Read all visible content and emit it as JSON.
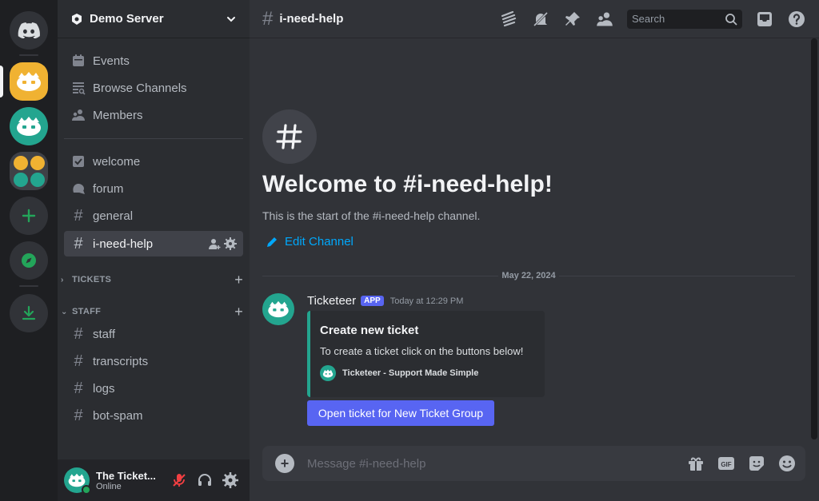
{
  "server": {
    "name": "Demo Server"
  },
  "sidebar": {
    "top_items": [
      {
        "label": "Events"
      },
      {
        "label": "Browse Channels"
      },
      {
        "label": "Members"
      }
    ],
    "channels": [
      {
        "label": "welcome"
      },
      {
        "label": "forum"
      },
      {
        "label": "general"
      },
      {
        "label": "i-need-help"
      }
    ],
    "categories": [
      {
        "label": "TICKETS"
      },
      {
        "label": "STAFF"
      }
    ],
    "staff_channels": [
      {
        "label": "staff"
      },
      {
        "label": "transcripts"
      },
      {
        "label": "logs"
      },
      {
        "label": "bot-spam"
      }
    ]
  },
  "user": {
    "name": "The Ticket...",
    "status": "Online"
  },
  "header": {
    "channel": "i-need-help",
    "search_placeholder": "Search"
  },
  "welcome": {
    "title": "Welcome to #i-need-help!",
    "subtitle": "This is the start of the #i-need-help channel.",
    "edit_label": "Edit Channel"
  },
  "messages": {
    "date_divider": "May 22, 2024",
    "author": "Ticketeer",
    "tag": "APP",
    "timestamp": "Today at 12:29 PM",
    "embed": {
      "title": "Create new ticket",
      "description": "To create a ticket click on the buttons below!",
      "footer": "Ticketeer - Support Made Simple"
    },
    "button_label": "Open ticket for New Ticket Group"
  },
  "composer": {
    "placeholder": "Message #i-need-help"
  },
  "colors": {
    "accent": "#5865f2",
    "bot_teal": "#23a58f",
    "link": "#00a8fc",
    "online": "#23a55a"
  }
}
